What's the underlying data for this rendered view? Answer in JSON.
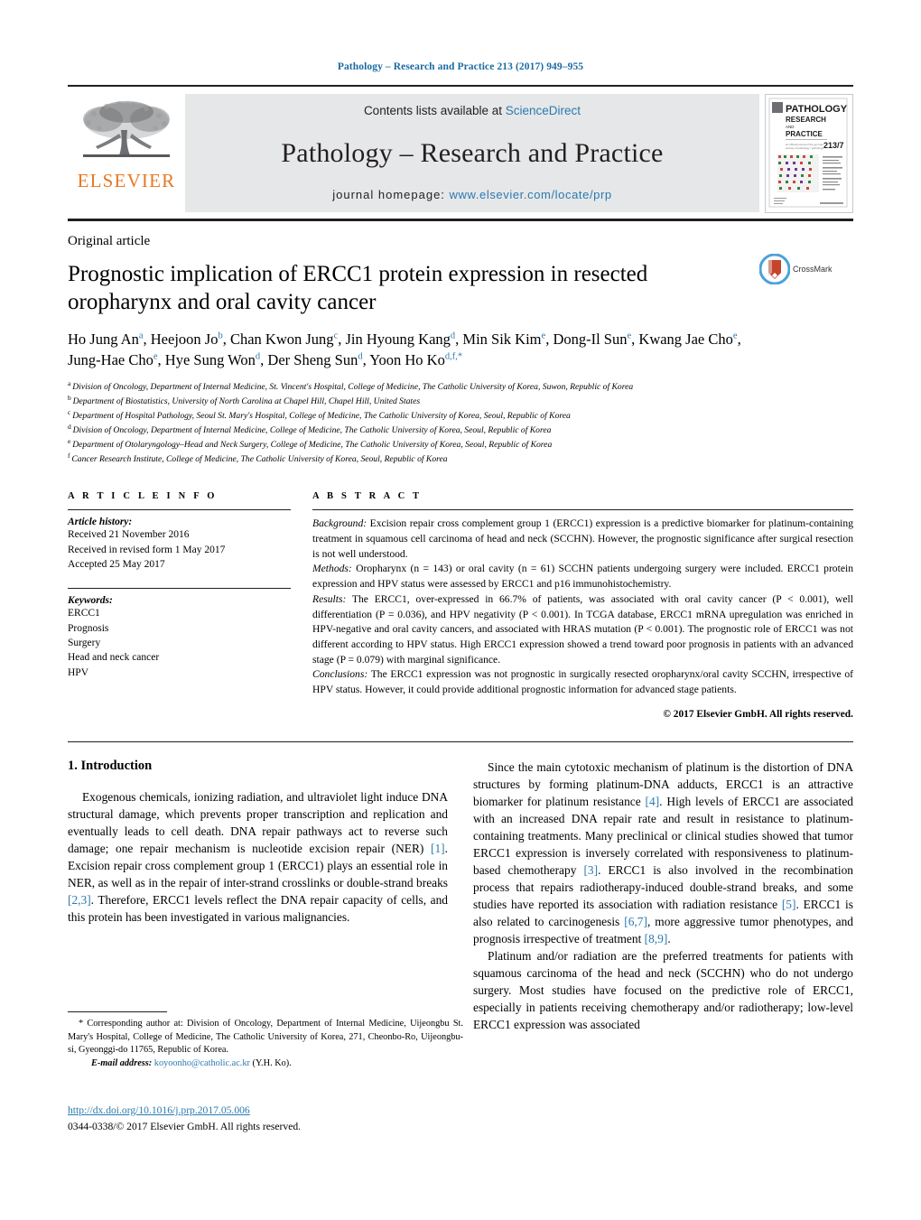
{
  "running_head": "Pathology – Research and Practice 213 (2017) 949–955",
  "masthead": {
    "contents_prefix": "Contents lists available at ",
    "sciencedirect": "ScienceDirect",
    "journal_title": "Pathology – Research and Practice",
    "homepage_label": "journal homepage:",
    "homepage_url": "www.elsevier.com/locate/prp",
    "publisher_wordmark": "ELSEVIER",
    "cover": {
      "line1": "PATHOLOGY",
      "line2": "RESEARCH",
      "line3": "AND",
      "line4": "PRACTICE",
      "volume": "213/7"
    }
  },
  "colors": {
    "link_blue": "#2a7ab0",
    "running_head_blue": "#1a6aa2",
    "elsevier_orange": "#E87722",
    "band_gray": "#e6e7e8",
    "crossmark_red": "#c8432b",
    "crossmark_blue": "#4ba3d8"
  },
  "article": {
    "type": "Original article",
    "title": "Prognostic implication of ERCC1 protein expression in resected oropharynx and oral cavity cancer",
    "crossmark_label": "CrossMark",
    "authors": [
      {
        "name": "Ho Jung An",
        "sup": "a"
      },
      {
        "name": "Heejoon Jo",
        "sup": "b"
      },
      {
        "name": "Chan Kwon Jung",
        "sup": "c"
      },
      {
        "name": "Jin Hyoung Kang",
        "sup": "d"
      },
      {
        "name": "Min Sik Kim",
        "sup": "e"
      },
      {
        "name": "Dong-Il Sun",
        "sup": "e"
      },
      {
        "name": "Kwang Jae Cho",
        "sup": "e"
      },
      {
        "name": "Jung-Hae Cho",
        "sup": "e"
      },
      {
        "name": "Hye Sung Won",
        "sup": "d"
      },
      {
        "name": "Der Sheng Sun",
        "sup": "d"
      },
      {
        "name": "Yoon Ho Ko",
        "sup": "d,f,*"
      }
    ],
    "affiliations": [
      {
        "key": "a",
        "text": "Division of Oncology, Department of Internal Medicine, St. Vincent's Hospital, College of Medicine, The Catholic University of Korea, Suwon, Republic of Korea"
      },
      {
        "key": "b",
        "text": "Department of Biostatistics, University of North Carolina at Chapel Hill, Chapel Hill, United States"
      },
      {
        "key": "c",
        "text": "Department of Hospital Pathology, Seoul St. Mary's Hospital, College of Medicine, The Catholic University of Korea, Seoul, Republic of Korea"
      },
      {
        "key": "d",
        "text": "Division of Oncology, Department of Internal Medicine, College of Medicine, The Catholic University of Korea, Seoul, Republic of Korea"
      },
      {
        "key": "e",
        "text": "Department of Otolaryngology–Head and Neck Surgery, College of Medicine, The Catholic University of Korea, Seoul, Republic of Korea"
      },
      {
        "key": "f",
        "text": "Cancer Research Institute, College of Medicine, The Catholic University of Korea, Seoul, Republic of Korea"
      }
    ]
  },
  "article_info": {
    "heading": "A R T I C L E   I N F O",
    "history_label": "Article history:",
    "history": [
      "Received 21 November 2016",
      "Received in revised form 1 May 2017",
      "Accepted 25 May 2017"
    ],
    "keywords_label": "Keywords:",
    "keywords": [
      "ERCC1",
      "Prognosis",
      "Surgery",
      "Head and neck cancer",
      "HPV"
    ]
  },
  "abstract": {
    "heading": "A B S T R A C T",
    "sections": [
      {
        "label": "Background:",
        "text": " Excision repair cross complement group 1 (ERCC1) expression is a predictive biomarker for platinum-containing treatment in squamous cell carcinoma of head and neck (SCCHN). However, the prognostic significance after surgical resection is not well understood."
      },
      {
        "label": "Methods:",
        "text": " Oropharynx (n = 143) or oral cavity (n = 61) SCCHN patients undergoing surgery were included. ERCC1 protein expression and HPV status were assessed by ERCC1 and p16 immunohistochemistry."
      },
      {
        "label": "Results:",
        "text": " The ERCC1, over-expressed in 66.7% of patients, was associated with oral cavity cancer (P < 0.001), well differentiation (P = 0.036), and HPV negativity (P < 0.001). In TCGA database, ERCC1 mRNA upregulation was enriched in HPV-negative and oral cavity cancers, and associated with HRAS mutation (P < 0.001). The prognostic role of ERCC1 was not different according to HPV status. High ERCC1 expression showed a trend toward poor prognosis in patients with an advanced stage (P = 0.079) with marginal significance."
      },
      {
        "label": "Conclusions:",
        "text": " The ERCC1 expression was not prognostic in surgically resected oropharynx/oral cavity SCCHN, irrespective of HPV status. However, it could provide additional prognostic information for advanced stage patients."
      }
    ],
    "copyright": "© 2017 Elsevier GmbH. All rights reserved."
  },
  "introduction": {
    "number_title": "1.  Introduction",
    "left_paragraphs": [
      {
        "parts": [
          {
            "t": "Exogenous chemicals, ionizing radiation, and ultraviolet light induce DNA structural damage, which prevents proper transcription and replication and eventually leads to cell death. DNA repair pathways act to reverse such damage; one repair mechanism is nucleotide excision repair (NER) "
          },
          {
            "t": "[1]",
            "ref": true
          },
          {
            "t": ". Excision repair cross complement group 1 (ERCC1) plays an essential role in NER, as well as in the repair of inter-strand crosslinks or double-strand breaks "
          },
          {
            "t": "[2,3]",
            "ref": true
          },
          {
            "t": ". Therefore, ERCC1 levels reflect the DNA repair capacity of cells, and this protein has been investigated in various malignancies."
          }
        ]
      }
    ],
    "right_paragraphs": [
      {
        "parts": [
          {
            "t": "Since the main cytotoxic mechanism of platinum is the distortion of DNA structures by forming platinum-DNA adducts, ERCC1 is an attractive biomarker for platinum resistance "
          },
          {
            "t": "[4]",
            "ref": true
          },
          {
            "t": ". High levels of ERCC1 are associated with an increased DNA repair rate and result in resistance to platinum-containing treatments. Many preclinical or clinical studies showed that tumor ERCC1 expression is inversely correlated with responsiveness to platinum-based chemotherapy "
          },
          {
            "t": "[3]",
            "ref": true
          },
          {
            "t": ". ERCC1 is also involved in the recombination process that repairs radiotherapy-induced double-strand breaks, and some studies have reported its association with radiation resistance "
          },
          {
            "t": "[5]",
            "ref": true
          },
          {
            "t": ". ERCC1 is also related to carcinogenesis "
          },
          {
            "t": "[6,7]",
            "ref": true
          },
          {
            "t": ", more aggressive tumor phenotypes, and prognosis irrespective of treatment "
          },
          {
            "t": "[8,9]",
            "ref": true
          },
          {
            "t": "."
          }
        ]
      },
      {
        "parts": [
          {
            "t": "Platinum and/or radiation are the preferred treatments for patients with squamous carcinoma of the head and neck (SCCHN) who do not undergo surgery. Most studies have focused on the predictive role of ERCC1, especially in patients receiving chemotherapy and/or radiotherapy; low-level ERCC1 expression was associated"
          }
        ]
      }
    ]
  },
  "footnotes": {
    "corresponding": "* Corresponding author at: Division of Oncology, Department of Internal Medicine, Uijeongbu St. Mary's Hospital, College of Medicine, The Catholic University of Korea, 271, Cheonbo-Ro, Uijeongbu-si, Gyeonggi-do 11765, Republic of Korea.",
    "email_label": "E-mail address:",
    "email": "koyoonho@catholic.ac.kr",
    "email_suffix": "(Y.H. Ko).",
    "doi": "http://dx.doi.org/10.1016/j.prp.2017.05.006",
    "issn_line": "0344-0338/© 2017 Elsevier GmbH. All rights reserved."
  }
}
